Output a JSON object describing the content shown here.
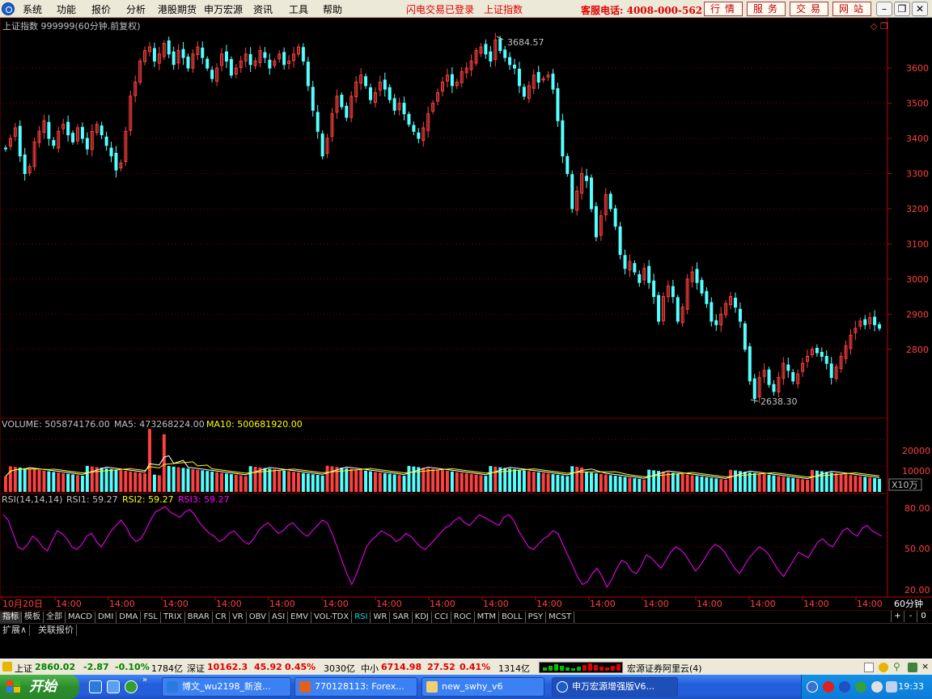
{
  "menubar": {
    "items": [
      "系统",
      "功能",
      "报价",
      "分析",
      "港股期货",
      "申万宏源",
      "资讯",
      "工具",
      "帮助"
    ],
    "flash_login": "闪电交易已登录",
    "index_link": "上证指数",
    "hotline": "客服电话: 4008-000-562",
    "quick_buttons": [
      "行情",
      "服务",
      "交易",
      "网站"
    ]
  },
  "chart_header": {
    "title": "上证指数 999999(60分钟.前复权)"
  },
  "price_panel": {
    "high_label": "3684.57",
    "low_label": "2638.30",
    "y_ticks": [
      "3600",
      "3500",
      "3400",
      "3300",
      "3200",
      "3100",
      "3000",
      "2900",
      "2800"
    ]
  },
  "volume_panel": {
    "volume_label": "VOLUME: 505874176.00",
    "ma5_label": "MA5: 473268224.00",
    "ma10_label": "MA10: 500681920.00",
    "y_ticks": [
      "20000",
      "10000"
    ],
    "unit": "X10万"
  },
  "rsi_panel": {
    "header": "RSI(14,14,14)",
    "rsi1_label": "RSI1: 59.27",
    "rsi2_label": "RSI2: 59.27",
    "rsi3_label": "RSI3: 59.27",
    "y_ticks": [
      "80.00",
      "50.00",
      "20.00"
    ]
  },
  "time_axis": {
    "labels": [
      "10月20日",
      "14:00",
      "14:00",
      "14:00",
      "14:00",
      "14:00",
      "14:00",
      "14:00",
      "14:00",
      "14:00",
      "14:00",
      "14:00",
      "14:00",
      "14:00",
      "14:00",
      "14:00",
      "14:00"
    ],
    "period": "60分钟"
  },
  "indicator_tabs": [
    "指标",
    "模板",
    "全部",
    "MACD",
    "DMI",
    "DMA",
    "FSL",
    "TRIX",
    "BRAR",
    "CR",
    "VR",
    "OBV",
    "ASI",
    "EMV",
    "VOL-TDX",
    "RSI",
    "WR",
    "SAR",
    "KDJ",
    "CCI",
    "ROC",
    "MTM",
    "BOLL",
    "PSY",
    "MCST"
  ],
  "active_indicator": "RSI",
  "tab_controls": [
    "+",
    "-",
    "0"
  ],
  "expand_tabs": [
    "扩展∧",
    "关联报价"
  ],
  "statusbar": {
    "sh_name": "上证",
    "sh_value": "2860.02",
    "sh_change": "-2.87",
    "sh_pct": "-0.10%",
    "sh_amount": "1784亿",
    "sz_name": "深证",
    "sz_value": "10162.3",
    "sz_change": "45.92",
    "sz_pct": "0.45%",
    "sz_amount": "3030亿",
    "zx_name": "中小",
    "zx_value": "6714.98",
    "zx_change": "27.52",
    "zx_pct": "0.41%",
    "zx_amount": "1314亿",
    "broker": "宏源证券阿里云(4)"
  },
  "taskbar": {
    "start_label": "开始",
    "tasks": [
      "博文_wu2198_新浪...",
      "770128113: Forex...",
      "new_swhy_v6",
      "申万宏源增强版V6..."
    ],
    "clock": "19:33"
  },
  "colors": {
    "up": "#ff4040",
    "down": "#54ffff",
    "grid": "#800000",
    "ma5": "#ffffff",
    "ma10": "#ffff00",
    "rsi": "#ff00ff"
  },
  "chart_data": {
    "type": "candlestick",
    "price_range": [
      2620,
      3720
    ],
    "price_closes": [
      3370,
      3400,
      3430,
      3350,
      3300,
      3320,
      3390,
      3420,
      3450,
      3400,
      3380,
      3420,
      3440,
      3410,
      3390,
      3430,
      3400,
      3370,
      3420,
      3440,
      3410,
      3380,
      3350,
      3310,
      3330,
      3420,
      3520,
      3560,
      3620,
      3650,
      3660,
      3620,
      3640,
      3670,
      3640,
      3610,
      3650,
      3630,
      3600,
      3640,
      3660,
      3630,
      3600,
      3570,
      3600,
      3640,
      3620,
      3580,
      3600,
      3620,
      3640,
      3610,
      3620,
      3650,
      3630,
      3600,
      3620,
      3640,
      3610,
      3620,
      3640,
      3660,
      3620,
      3550,
      3480,
      3420,
      3350,
      3400,
      3470,
      3520,
      3490,
      3460,
      3520,
      3560,
      3580,
      3550,
      3510,
      3530,
      3560,
      3540,
      3510,
      3480,
      3500,
      3470,
      3440,
      3420,
      3400,
      3430,
      3470,
      3500,
      3530,
      3560,
      3580,
      3550,
      3560,
      3590,
      3600,
      3620,
      3650,
      3660,
      3640,
      3620,
      3680,
      3650,
      3630,
      3610,
      3600,
      3550,
      3520,
      3550,
      3580,
      3560,
      3570,
      3580,
      3540,
      3450,
      3350,
      3300,
      3200,
      3250,
      3300,
      3280,
      3200,
      3120,
      3180,
      3240,
      3200,
      3150,
      3070,
      3030,
      3050,
      3020,
      2990,
      3030,
      2990,
      2950,
      2880,
      2950,
      2980,
      2950,
      2880,
      2920,
      3000,
      3020,
      2990,
      2960,
      2930,
      2880,
      2870,
      2900,
      2930,
      2950,
      2920,
      2880,
      2800,
      2710,
      2660,
      2720,
      2740,
      2700,
      2680,
      2720,
      2760,
      2740,
      2710,
      2730,
      2760,
      2780,
      2800,
      2790,
      2780,
      2760,
      2720,
      2750,
      2780,
      2810,
      2840,
      2860,
      2880,
      2870,
      2890,
      2870,
      2860
    ],
    "volume_range": [
      0,
      25000
    ],
    "volume_ma_values": [
      9000,
      11000
    ],
    "volume_spikes": [
      {
        "index": 30,
        "value": 24000
      },
      {
        "index": 33,
        "value": 22000
      }
    ],
    "rsi_range": [
      15,
      85
    ],
    "rsi_values": [
      74,
      70,
      60,
      50,
      48,
      52,
      58,
      55,
      50,
      47,
      55,
      62,
      60,
      56,
      50,
      48,
      52,
      58,
      60,
      54,
      50,
      56,
      62,
      66,
      70,
      65,
      58,
      54,
      56,
      62,
      70,
      76,
      78,
      80,
      76,
      74,
      72,
      76,
      78,
      74,
      68,
      64,
      60,
      58,
      54,
      56,
      60,
      62,
      58,
      54,
      52,
      56,
      62,
      66,
      68,
      64,
      60,
      62,
      66,
      68,
      64,
      60,
      58,
      62,
      66,
      70,
      68,
      60,
      50,
      40,
      30,
      22,
      30,
      40,
      50,
      55,
      58,
      62,
      60,
      58,
      54,
      56,
      60,
      58,
      54,
      50,
      48,
      52,
      56,
      60,
      64,
      66,
      70,
      72,
      68,
      66,
      70,
      74,
      72,
      70,
      68,
      66,
      72,
      74,
      70,
      62,
      56,
      50,
      48,
      52,
      56,
      58,
      62,
      60,
      52,
      44,
      36,
      28,
      22,
      24,
      30,
      34,
      28,
      20,
      26,
      34,
      40,
      38,
      32,
      30,
      36,
      44,
      42,
      38,
      34,
      40,
      46,
      50,
      48,
      44,
      38,
      32,
      36,
      42,
      48,
      52,
      50,
      46,
      40,
      34,
      30,
      36,
      42,
      46,
      50,
      48,
      44,
      38,
      32,
      28,
      34,
      40,
      46,
      44,
      42,
      48,
      54,
      56,
      52,
      50,
      56,
      62,
      64,
      60,
      58,
      64,
      66,
      62,
      60,
      58
    ]
  }
}
